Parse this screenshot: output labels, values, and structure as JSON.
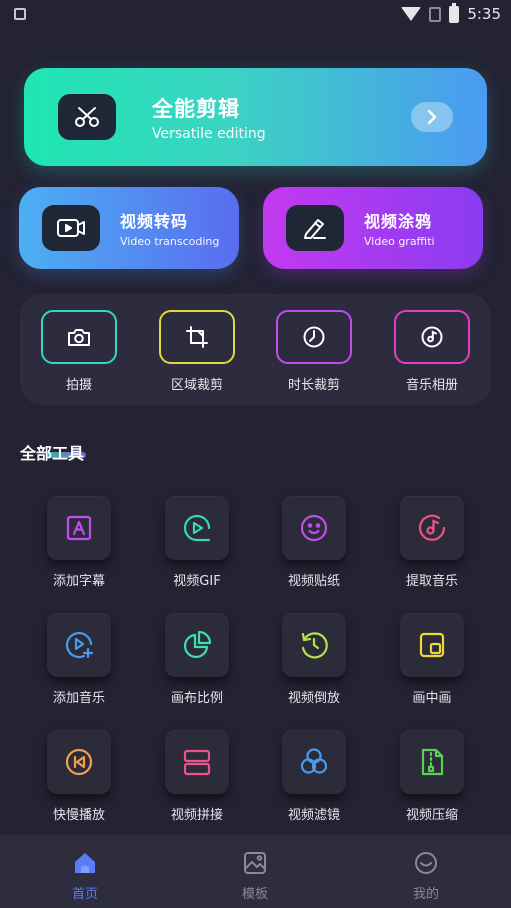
{
  "status": {
    "time": "5:35"
  },
  "hero": {
    "title": "全能剪辑",
    "subtitle": "Versatile editing",
    "icon": "scissors-icon",
    "accent_from": "#1fe6b2",
    "accent_to": "#4b9af2"
  },
  "cards": [
    {
      "title": "视频转码",
      "subtitle": "Video transcoding",
      "icon": "video-camera-icon",
      "accent_from": "#4cb0f2",
      "accent_to": "#5a6cf0"
    },
    {
      "title": "视频涂鸦",
      "subtitle": "Video graffiti",
      "icon": "pen-icon",
      "accent_from": "#c33af0",
      "accent_to": "#8a3cf0"
    }
  ],
  "quick": [
    {
      "label": "拍摄",
      "icon": "camera-icon",
      "color": "#35d8b8"
    },
    {
      "label": "区域裁剪",
      "icon": "crop-icon",
      "color": "#e0d83a"
    },
    {
      "label": "时长裁剪",
      "icon": "clock-icon",
      "color": "#c24cf0"
    },
    {
      "label": "音乐相册",
      "icon": "music-disc-icon",
      "color": "#e040b8"
    }
  ],
  "section": {
    "title": "全部工具"
  },
  "tools": [
    {
      "label": "添加字幕",
      "icon": "text-letter-icon",
      "color": "#c24cf0"
    },
    {
      "label": "视频GIF",
      "icon": "play-circle-icon",
      "color": "#35d8b8"
    },
    {
      "label": "视频贴纸",
      "icon": "smiley-icon",
      "color": "#c24cf0"
    },
    {
      "label": "提取音乐",
      "icon": "music-disc-icon",
      "color": "#f0508c"
    },
    {
      "label": "添加音乐",
      "icon": "play-add-icon",
      "color": "#4a9af0"
    },
    {
      "label": "画布比例",
      "icon": "pie-chart-icon",
      "color": "#3ae0b0"
    },
    {
      "label": "视频倒放",
      "icon": "rewind-clock-icon",
      "color": "#b8e04a"
    },
    {
      "label": "画中画",
      "icon": "picture-in-picture-icon",
      "color": "#f0d83a"
    },
    {
      "label": "快慢播放",
      "icon": "skip-back-icon",
      "color": "#f0a050"
    },
    {
      "label": "视频拼接",
      "icon": "split-rect-icon",
      "color": "#f0508c"
    },
    {
      "label": "视频滤镜",
      "icon": "filter-circles-icon",
      "color": "#4a9af0"
    },
    {
      "label": "视频压缩",
      "icon": "zip-file-icon",
      "color": "#5ad050"
    }
  ],
  "nav": [
    {
      "label": "首页",
      "icon": "home-icon",
      "active": true,
      "color": "#5b7cf8"
    },
    {
      "label": "模板",
      "icon": "image-template-icon",
      "active": false,
      "color": "#8a8a96"
    },
    {
      "label": "我的",
      "icon": "profile-smile-icon",
      "active": false,
      "color": "#8a8a96"
    }
  ]
}
